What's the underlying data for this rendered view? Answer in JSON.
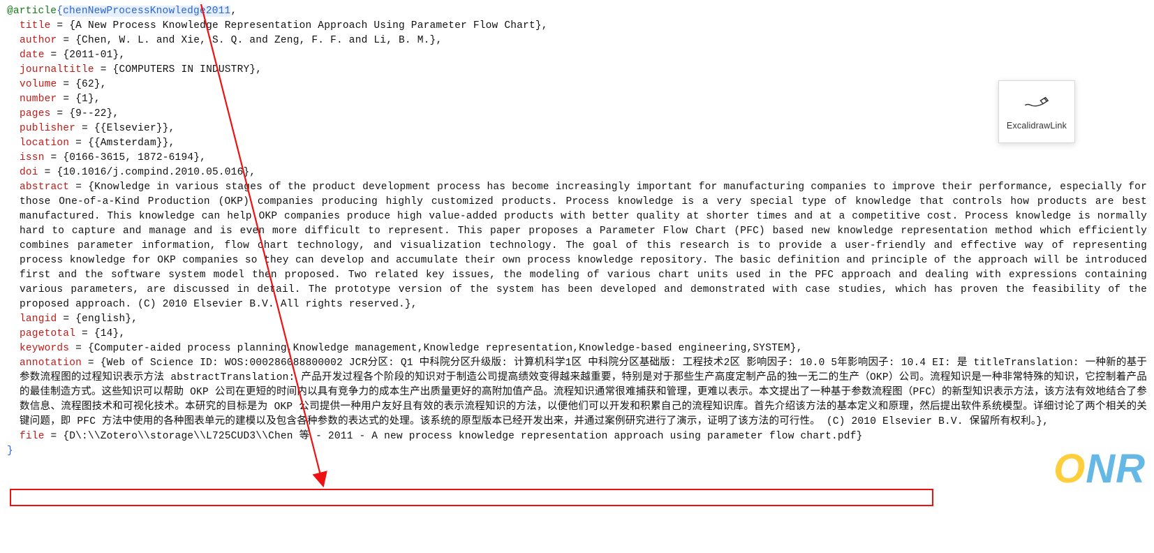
{
  "bibtex": {
    "entry_type": "@article",
    "open": "{",
    "citekey": "chenNewProcessKnowledge2011",
    "after_key": ",",
    "close": "}",
    "fields": {
      "title": {
        "key": "title",
        "value": "{A New Process Knowledge Representation Approach Using Parameter Flow Chart}"
      },
      "author": {
        "key": "author",
        "value": "{Chen, W. L. and Xie, S. Q. and Zeng, F. F. and Li, B. M.}"
      },
      "date": {
        "key": "date",
        "value": "{2011-01}"
      },
      "journaltitle": {
        "key": "journaltitle",
        "value": "{COMPUTERS IN INDUSTRY}"
      },
      "volume": {
        "key": "volume",
        "value": "{62}"
      },
      "number": {
        "key": "number",
        "value": "{1}"
      },
      "pages": {
        "key": "pages",
        "value": "{9--22}"
      },
      "publisher": {
        "key": "publisher",
        "value": "{{Elsevier}}"
      },
      "location": {
        "key": "location",
        "value": "{{Amsterdam}}"
      },
      "issn": {
        "key": "issn",
        "value": "{0166-3615, 1872-6194}"
      },
      "doi": {
        "key": "doi",
        "value": "{10.1016/j.compind.2010.05.016}"
      },
      "abstract": {
        "key": "abstract",
        "value": "{Knowledge in various stages of the product development process has become increasingly important for manufacturing companies to improve their performance, especially for those One-of-a-Kind Production (OKP) companies producing highly customized products. Process knowledge is a very special type of knowledge that controls how products are best manufactured. This knowledge can help OKP companies produce high value-added products with better quality at shorter times and at a competitive cost. Process knowledge is normally hard to capture and manage and is even more difficult to represent. This paper proposes a Parameter Flow Chart (PFC) based new knowledge representation method which efficiently combines parameter information, flow chart technology, and visualization technology. The goal of this research is to provide a user-friendly and effective way of representing process knowledge for OKP companies so they can develop and accumulate their own process knowledge repository. The basic definition and principle of the approach will be introduced first and the software system model then proposed. Two related key issues, the modeling of various chart units used in the PFC approach and dealing with expressions containing various parameters, are discussed in detail. The prototype version of the system has been developed and demonstrated with case studies, which has proven the feasibility of the proposed approach. (C) 2010 Elsevier B.V. All rights reserved.}"
      },
      "langid": {
        "key": "langid",
        "value": "{english}"
      },
      "pagetotal": {
        "key": "pagetotal",
        "value": "{14}"
      },
      "keywords": {
        "key": "keywords",
        "value": "{Computer-aided process planning,Knowledge management,Knowledge representation,Knowledge-based engineering,SYSTEM}"
      },
      "annotation": {
        "key": "annotation",
        "value": "{Web of Science ID: WOS:000286088800002 JCR分区: Q1 中科院分区升级版: 计算机科学1区 中科院分区基础版: 工程技术2区 影响因子: 10.0 5年影响因子: 10.4 EI: 是 titleTranslation: 一种新的基于参数流程图的过程知识表示方法 abstractTranslation:  产品开发过程各个阶段的知识对于制造公司提高绩效变得越来越重要，特别是对于那些生产高度定制产品的独一无二的生产（OKP）公司。流程知识是一种非常特殊的知识，它控制着产品的最佳制造方式。这些知识可以帮助 OKP 公司在更短的时间内以具有竞争力的成本生产出质量更好的高附加值产品。流程知识通常很难捕获和管理，更难以表示。本文提出了一种基于参数流程图（PFC）的新型知识表示方法，该方法有效地结合了参数信息、流程图技术和可视化技术。本研究的目标是为 OKP 公司提供一种用户友好且有效的表示流程知识的方法，以便他们可以开发和积累自己的流程知识库。首先介绍该方法的基本定义和原理，然后提出软件系统模型。详细讨论了两个相关的关键问题，即 PFC 方法中使用的各种图表单元的建模以及包含各种参数的表达式的处理。该系统的原型版本已经开发出来，并通过案例研究进行了演示，证明了该方法的可行性。 (C) 2010 Elsevier B.V. 保留所有权利。}"
      },
      "file": {
        "key": "file",
        "value": "{D\\:\\\\Zotero\\\\storage\\\\L725CUD3\\\\Chen 等 - 2011 - A new process knowledge representation approach using parameter flow chart.pdf}"
      }
    }
  },
  "excalidraw": {
    "label": "ExcalidrawLink"
  },
  "watermark": {
    "text": "ONR"
  }
}
